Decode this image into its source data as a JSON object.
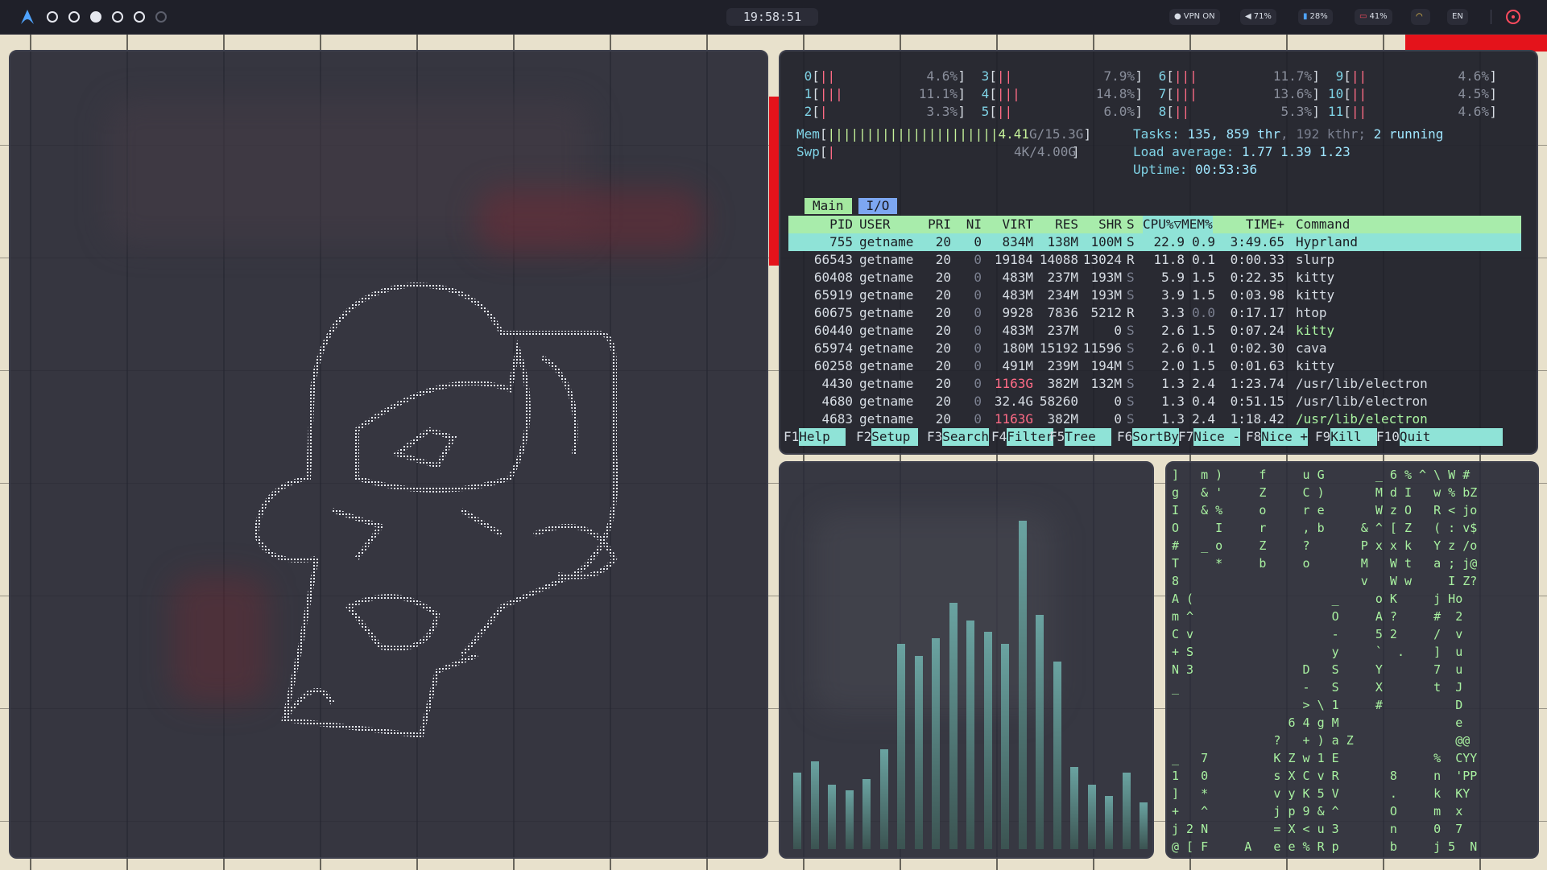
{
  "topbar": {
    "clock": "19:58:51",
    "vpn": "VPN ON",
    "volume": "71%",
    "brightness": "28%",
    "battery": "41%",
    "language": "EN",
    "workspaces": [
      {
        "state": "empty"
      },
      {
        "state": "empty"
      },
      {
        "state": "active"
      },
      {
        "state": "empty"
      },
      {
        "state": "empty"
      },
      {
        "state": "dim"
      }
    ],
    "colors": {
      "bar_bg": "#1f2029",
      "accent": "#ff4b5e",
      "arch": "#4fa3ff"
    }
  },
  "htop": {
    "cpus": [
      {
        "id": "0",
        "bars": "||",
        "pct": "4.6%"
      },
      {
        "id": "1",
        "bars": "|||",
        "pct": "11.1%"
      },
      {
        "id": "2",
        "bars": "|",
        "pct": "3.3%"
      },
      {
        "id": "3",
        "bars": "||",
        "pct": "7.9%"
      },
      {
        "id": "4",
        "bars": "|||",
        "pct": "14.8%"
      },
      {
        "id": "5",
        "bars": "||",
        "pct": "6.0%"
      },
      {
        "id": "6",
        "bars": "|||",
        "pct": "11.7%"
      },
      {
        "id": "7",
        "bars": "|||",
        "pct": "13.6%"
      },
      {
        "id": "8",
        "bars": "||",
        "pct": "5.3%"
      },
      {
        "id": "9",
        "bars": "||",
        "pct": "4.6%"
      },
      {
        "id": "10",
        "bars": "||",
        "pct": "4.5%"
      },
      {
        "id": "11",
        "bars": "||",
        "pct": "4.6%"
      }
    ],
    "mem_label": "Mem",
    "mem_bar": "||||||||||||||||||||||4.41",
    "mem_total": "G/15.3G",
    "swp_label": "Swp",
    "swp_bar": "|",
    "swp_value": "4K/4.00G",
    "tasks": "Tasks: ",
    "tasks_n": "135",
    "thr": ", 859 thr",
    "kthr": ", 192 kthr;",
    "running": " 2 running",
    "load_label": "Load average: ",
    "load_values": "1.77 1.39 1.23",
    "uptime_label": "Uptime: ",
    "uptime_value": "00:53:36",
    "tab_main": "Main",
    "tab_io": "I/O",
    "headers": {
      "pid": "PID",
      "user": "USER",
      "pri": "PRI",
      "ni": "NI",
      "virt": "VIRT",
      "res": "RES",
      "shr": "SHR",
      "s": "S",
      "cpu": "CPU%▽MEM%",
      "time": "TIME+",
      "cmd": "Command"
    },
    "processes": [
      {
        "pid": "755",
        "user": "getname",
        "pri": "20",
        "ni": "0",
        "virt": "834M",
        "res": "138M",
        "shr": "100M",
        "s": "S",
        "cpu": "22.9",
        "mem": "0.9",
        "time": "3:49.65",
        "cmd": "Hyprland"
      },
      {
        "pid": "66543",
        "user": "getname",
        "pri": "20",
        "ni": "0",
        "virt": "19184",
        "res": "14088",
        "shr": "13024",
        "s": "R",
        "cpu": "11.8",
        "mem": "0.1",
        "time": "0:00.33",
        "cmd": "slurp"
      },
      {
        "pid": "60408",
        "user": "getname",
        "pri": "20",
        "ni": "0",
        "virt": "483M",
        "res": "237M",
        "shr": "193M",
        "s": "S",
        "cpu": "5.9",
        "mem": "1.5",
        "time": "0:22.35",
        "cmd": "kitty"
      },
      {
        "pid": "65919",
        "user": "getname",
        "pri": "20",
        "ni": "0",
        "virt": "483M",
        "res": "234M",
        "shr": "193M",
        "s": "S",
        "cpu": "3.9",
        "mem": "1.5",
        "time": "0:03.98",
        "cmd": "kitty"
      },
      {
        "pid": "60675",
        "user": "getname",
        "pri": "20",
        "ni": "0",
        "virt": "9928",
        "res": "7836",
        "shr": "5212",
        "s": "R",
        "cpu": "3.3",
        "mem": "0.0",
        "time": "0:17.17",
        "cmd": "htop"
      },
      {
        "pid": "60440",
        "user": "getname",
        "pri": "20",
        "ni": "0",
        "virt": "483M",
        "res": "237M",
        "shr": "0",
        "s": "S",
        "cpu": "2.6",
        "mem": "1.5",
        "time": "0:07.24",
        "cmd": "kitty"
      },
      {
        "pid": "65974",
        "user": "getname",
        "pri": "20",
        "ni": "0",
        "virt": "180M",
        "res": "15192",
        "shr": "11596",
        "s": "S",
        "cpu": "2.6",
        "mem": "0.1",
        "time": "0:02.30",
        "cmd": "cava"
      },
      {
        "pid": "60258",
        "user": "getname",
        "pri": "20",
        "ni": "0",
        "virt": "491M",
        "res": "239M",
        "shr": "194M",
        "s": "S",
        "cpu": "2.0",
        "mem": "1.5",
        "time": "0:01.63",
        "cmd": "kitty"
      },
      {
        "pid": "4430",
        "user": "getname",
        "pri": "20",
        "ni": "0",
        "virt": "1163G",
        "res": "382M",
        "shr": "132M",
        "s": "S",
        "cpu": "1.3",
        "mem": "2.4",
        "time": "1:23.74",
        "cmd": "/usr/lib/electron"
      },
      {
        "pid": "4680",
        "user": "getname",
        "pri": "20",
        "ni": "0",
        "virt": "32.4G",
        "res": "58260",
        "shr": "0",
        "s": "S",
        "cpu": "1.3",
        "mem": "0.4",
        "time": "0:51.15",
        "cmd": "/usr/lib/electron"
      },
      {
        "pid": "4683",
        "user": "getname",
        "pri": "20",
        "ni": "0",
        "virt": "1163G",
        "res": "382M",
        "shr": "0",
        "s": "S",
        "cpu": "1.3",
        "mem": "2.4",
        "time": "1:18.42",
        "cmd": "/usr/lib/electron"
      }
    ],
    "fkeys": [
      {
        "k": "F1",
        "v": "Help  "
      },
      {
        "k": "F2",
        "v": "Setup "
      },
      {
        "k": "F3",
        "v": "Search"
      },
      {
        "k": "F4",
        "v": "Filter"
      },
      {
        "k": "F5",
        "v": "Tree  "
      },
      {
        "k": "F6",
        "v": "SortBy"
      },
      {
        "k": "F7",
        "v": "Nice -"
      },
      {
        "k": "F8",
        "v": "Nice +"
      },
      {
        "k": "F9",
        "v": "Kill  "
      },
      {
        "k": "F10",
        "v": "Quit  "
      }
    ]
  },
  "cava": {
    "levels": [
      0.13,
      0.15,
      0.11,
      0.1,
      0.12,
      0.17,
      0.35,
      0.33,
      0.36,
      0.42,
      0.39,
      0.37,
      0.35,
      0.56,
      0.4,
      0.32,
      0.14,
      0.11,
      0.09,
      0.13,
      0.08
    ]
  },
  "matrix": {
    "lines": [
      "]   m )     f     u G       _ 6 % ^ \\ W #",
      "g   & '     Z     C )       M d I   w % bZ",
      "I   & %     o     r e       W z O   R < jo",
      "O     I     r     , b     & ^ [ Z   ( : v$",
      "#   _ o     Z     ?       P x x k   Y z /o",
      "T     *     b     o       M   W t   a ; j@",
      "8                         v   W w     I Z?",
      "A (                   _     o K     j Ho",
      "m ^                   O     A ?     #  2",
      "C v                   -     5 2     /  v",
      "+ S                   y     `  .    ]  u",
      "N 3               D   S     Y       7  u",
      "_                 -   S     X       t  J",
      "                  > \\ 1     #          D",
      "                6 4 g M                e",
      "              ?   + ) a Z              @@",
      "_   7         K Z w 1 E             %  CYY",
      "1   0         s X C v R       8     n  'PP",
      "]   *         v y K 5 V       .     k  KY",
      "+   ^         j p 9 & ^       O     m  x",
      "j 2 N         = X < u 3       n     0  7",
      "@ [ F     A   e e % R p       b     j 5  N"
    ]
  }
}
